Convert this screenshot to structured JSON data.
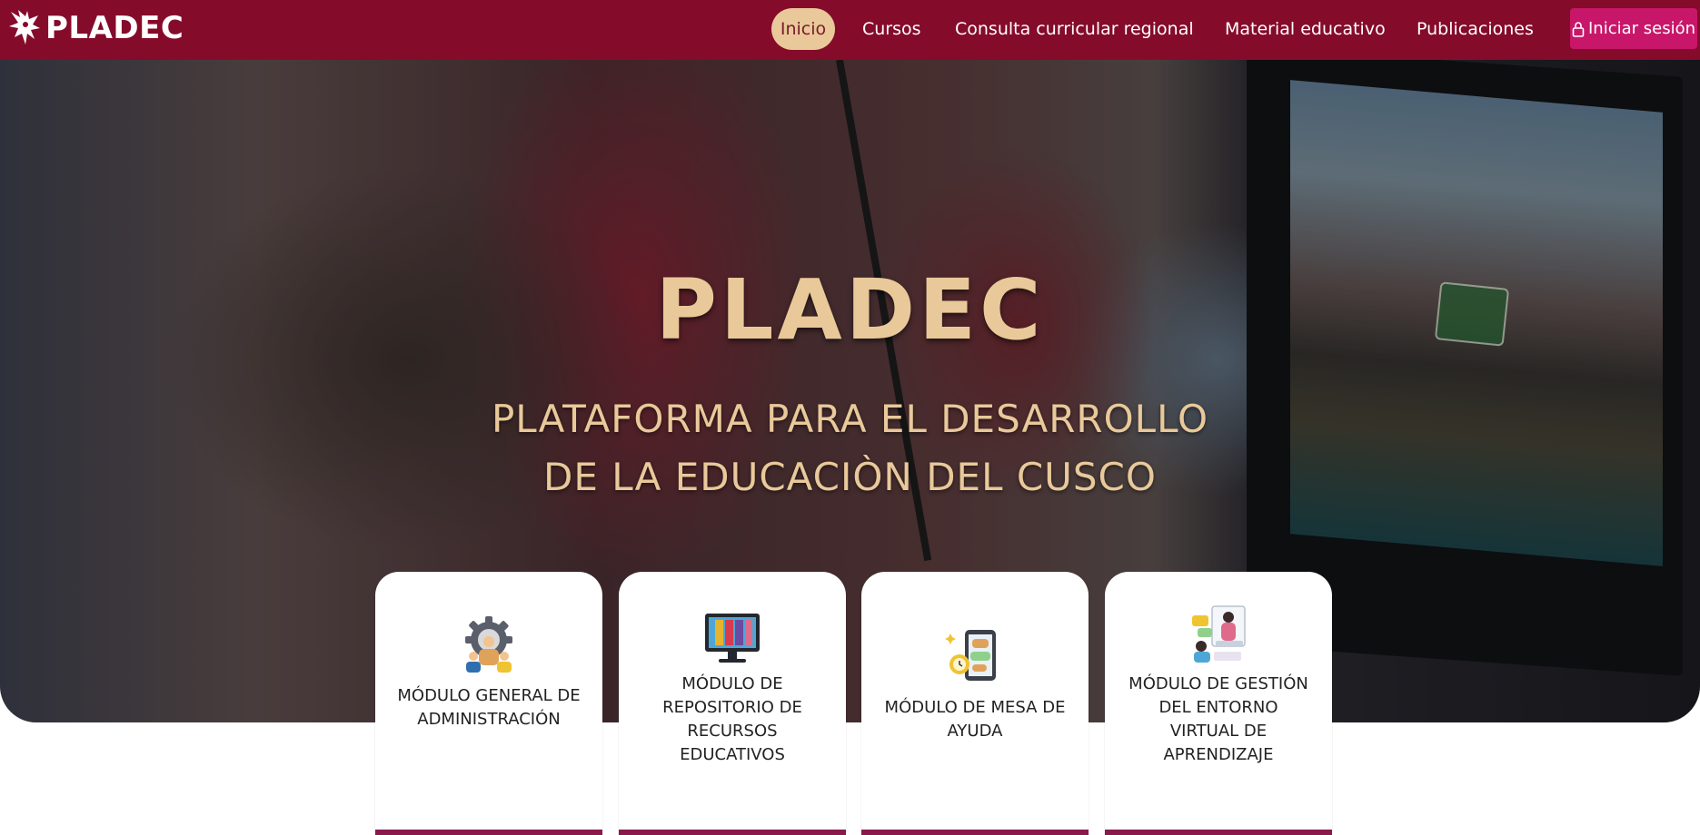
{
  "brand": {
    "name": "PLADEC",
    "color_primary": "#850b2a",
    "color_accent": "#e9c99a",
    "color_login": "#c8176a"
  },
  "nav": {
    "items": [
      {
        "label": "Inicio",
        "active": true
      },
      {
        "label": "Cursos",
        "active": false
      },
      {
        "label": "Consulta curricular regional",
        "active": false
      },
      {
        "label": "Material educativo",
        "active": false
      },
      {
        "label": "Publicaciones",
        "active": false
      }
    ],
    "login": {
      "label": "Iniciar sesión",
      "icon": "lock-icon"
    }
  },
  "hero": {
    "title": "PLADEC",
    "subtitle_line1": "PLATAFORMA PARA EL DESARROLLO",
    "subtitle_line2": "DE LA EDUCACIÒN DEL CUSCO"
  },
  "modules": [
    {
      "label": "MÓDULO GENERAL DE ADMINISTRACIÓN",
      "icon": "gear-people-icon"
    },
    {
      "label": "MÓDULO DE REPOSITORIO DE RECURSOS EDUCATIVOS",
      "icon": "monitor-binders-icon"
    },
    {
      "label": "MÓDULO DE MESA DE AYUDA",
      "icon": "tablet-chat-icon"
    },
    {
      "label": "MÓDULO DE GESTIÓN DEL ENTORNO VIRTUAL DE APRENDIZAJE",
      "icon": "virtual-classroom-icon"
    }
  ]
}
